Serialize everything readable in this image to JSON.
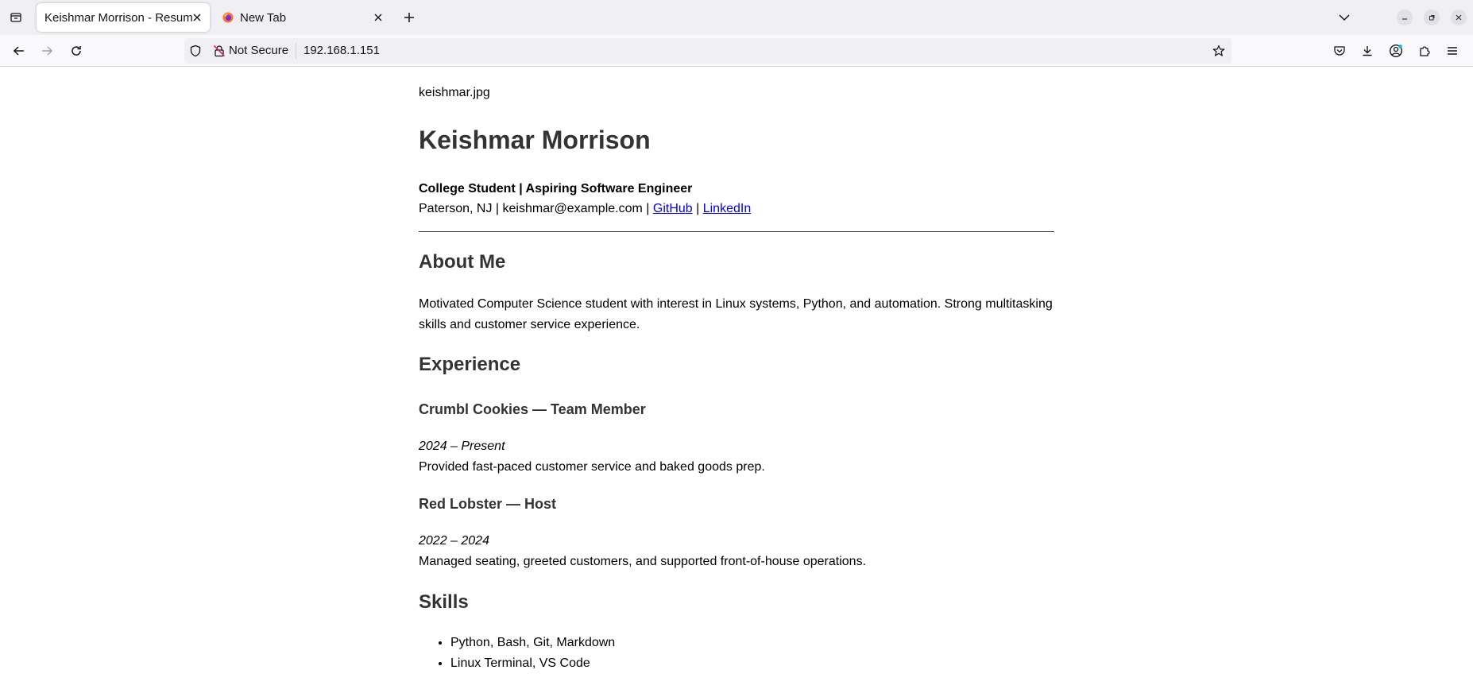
{
  "browser": {
    "tabs": [
      {
        "title": "Keishmar Morrison - Resume",
        "active": true
      },
      {
        "title": "New Tab",
        "active": false
      }
    ],
    "url_security": "Not Secure",
    "url": "192.168.1.151"
  },
  "page": {
    "image_alt": "keishmar.jpg",
    "name": "Keishmar Morrison",
    "tagline": "College Student | Aspiring Software Engineer",
    "contact": {
      "location_email": "Paterson, NJ | keishmar@example.com | ",
      "github_label": "GitHub",
      "separator": " | ",
      "linkedin_label": "LinkedIn"
    },
    "about": {
      "heading": "About Me",
      "text": "Motivated Computer Science student with interest in Linux systems, Python, and automation. Strong multitasking skills and customer service experience."
    },
    "experience": {
      "heading": "Experience",
      "jobs": [
        {
          "title": "Crumbl Cookies — Team Member",
          "dates": "2024 – Present",
          "description": "Provided fast-paced customer service and baked goods prep."
        },
        {
          "title": "Red Lobster — Host",
          "dates": "2022 – 2024",
          "description": "Managed seating, greeted customers, and supported front-of-house operations."
        }
      ]
    },
    "skills": {
      "heading": "Skills",
      "items": [
        "Python, Bash, Git, Markdown",
        "Linux Terminal, VS Code"
      ]
    }
  }
}
